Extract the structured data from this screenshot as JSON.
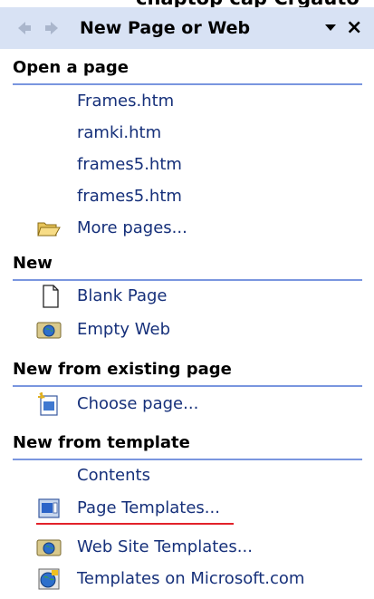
{
  "header": {
    "title": "New Page or Web",
    "cropped_above": "chaptop cap Crgauto"
  },
  "sections": {
    "open": {
      "title": "Open a page",
      "items": [
        "Frames.htm",
        "ramki.htm",
        "frames5.htm",
        "frames5.htm"
      ],
      "more": "More pages..."
    },
    "new": {
      "title": "New",
      "blank": "Blank Page",
      "empty_web": "Empty Web"
    },
    "existing": {
      "title": "New from existing page",
      "choose": "Choose page..."
    },
    "template": {
      "title": "New from template",
      "contents": "Contents",
      "page_templates": "Page Templates...",
      "web_site_templates": "Web Site Templates...",
      "microsoft": "Templates on Microsoft.com"
    }
  },
  "colors": {
    "titlebar": "#d8e2f4",
    "link": "#16307a",
    "section_rule": "#7a96df",
    "underline": "#e2222a"
  },
  "icons": {
    "back": "back-arrow-icon",
    "forward": "forward-arrow-icon",
    "dropdown": "chevron-down-icon",
    "close": "close-icon",
    "folder": "open-folder-icon",
    "page": "blank-page-icon",
    "web": "web-folder-icon",
    "choose": "choose-page-icon",
    "template": "page-template-icon",
    "globe": "globe-icon"
  }
}
